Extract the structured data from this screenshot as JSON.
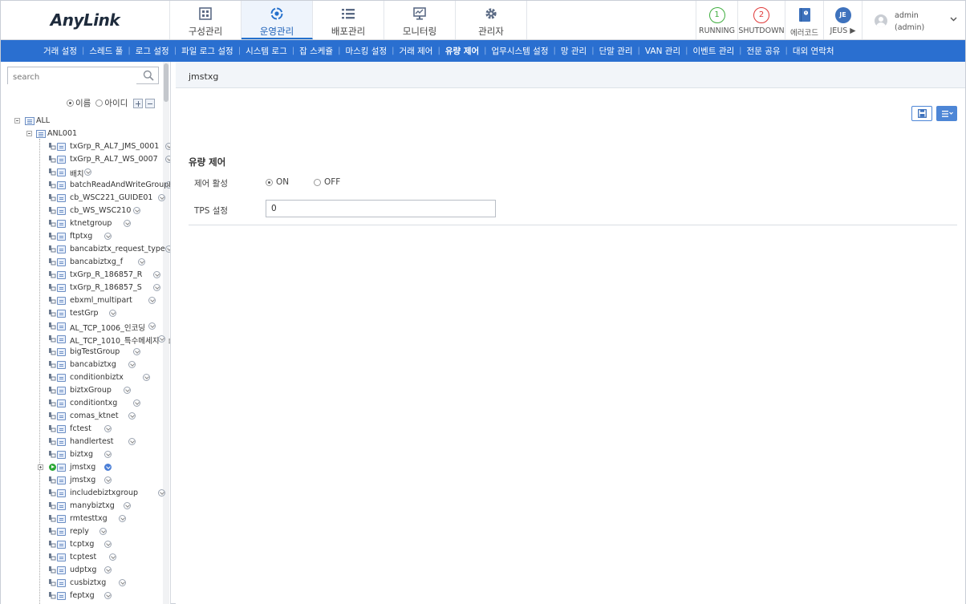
{
  "app": {
    "logo": "AnyLink"
  },
  "header": {
    "main_tabs": [
      {
        "label": "구성관리",
        "icon": "grid-icon"
      },
      {
        "label": "운영관리",
        "icon": "operation-icon"
      },
      {
        "label": "배포관리",
        "icon": "list-icon"
      },
      {
        "label": "모니터링",
        "icon": "monitor-icon"
      },
      {
        "label": "관리자",
        "icon": "gear-icon"
      }
    ],
    "status": [
      {
        "label": "RUNNING",
        "count": "1",
        "color": "#3fae3f"
      },
      {
        "label": "SHUTDOWN",
        "count": "2",
        "color": "#e03a3a"
      },
      {
        "label": "에러코드",
        "icon": "error-code-icon"
      },
      {
        "label": "JEUS ▶",
        "badge": "JE"
      }
    ],
    "user": {
      "name": "admin",
      "role": "(admin)"
    }
  },
  "subnav": {
    "items": [
      "거래 설정",
      "스레드 풀",
      "로그 설정",
      "파일 로그 설정",
      "시스템 로그",
      "잡 스케쥴",
      "마스킹 설정",
      "거래 제어",
      "유량 제어",
      "업무시스템 설정",
      "망 관리",
      "단말 관리",
      "VAN 관리",
      "이벤트 관리",
      "전문 공유",
      "대외 연락처"
    ],
    "active": "유량 제어"
  },
  "sidebar": {
    "search_placeholder": "search",
    "radio_name": "이름",
    "radio_id": "아이디",
    "tree_root": "ALL",
    "tree_node": "ANL001",
    "groups": [
      "txGrp_R_AL7_JMS_0001",
      "txGrp_R_AL7_WS_0007",
      "배치",
      "batchReadAndWriteGroupN",
      "cb_WSC221_GUIDE01",
      "cb_WS_WSC210",
      "ktnetgroup",
      "ftptxg",
      "bancabiztx_request_type",
      "bancabiztxg_f",
      "txGrp_R_186857_R",
      "txGrp_R_186857_S",
      "ebxml_multipart",
      "testGrp",
      "AL_TCP_1006_인코딩",
      "AL_TCP_1010_특수메세지",
      "bigTestGroup",
      "bancabiztxg",
      "conditionbiztx",
      "biztxGroup",
      "conditiontxg",
      "comas_ktnet",
      "fctest",
      "handlertest",
      "biztxg",
      "jmstxg",
      "jmstxg",
      "includebiztxgroup",
      "manybiztxg",
      "rmtesttxg",
      "reply",
      "tcptxg",
      "tcptest",
      "udptxg",
      "cusbiztxg",
      "feptxg"
    ]
  },
  "content": {
    "title": "jmstxg",
    "section_title": "유량 제어",
    "enable_label": "제어 활성",
    "on_label": "ON",
    "off_label": "OFF",
    "tps_label": "TPS 설정",
    "tps_value": "0"
  },
  "colors": {
    "accent": "#2a6fd0",
    "running": "#3fae3f",
    "shutdown": "#e03a3a"
  }
}
